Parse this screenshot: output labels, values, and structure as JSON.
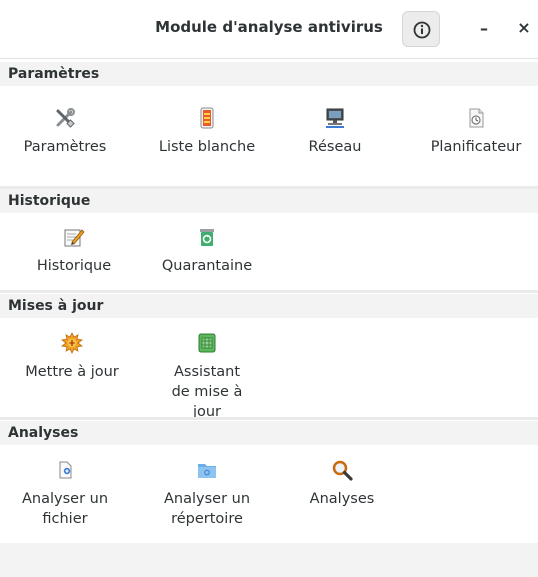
{
  "window": {
    "title": "Module d'analyse antivirus",
    "minimize_label": "–",
    "close_label": "×"
  },
  "sections": [
    {
      "header": "Paramètres",
      "items": [
        {
          "label": "Paramètres",
          "icon": "tools-icon"
        },
        {
          "label": "Liste blanche",
          "icon": "whitelist-icon"
        },
        {
          "label": "Réseau",
          "icon": "network-icon"
        },
        {
          "label": "Planificateur",
          "icon": "scheduler-icon"
        }
      ]
    },
    {
      "header": "Historique",
      "items": [
        {
          "label": "Historique",
          "icon": "history-icon"
        },
        {
          "label": "Quarantaine",
          "icon": "quarantine-icon"
        }
      ]
    },
    {
      "header": "Mises à jour",
      "items": [
        {
          "label": "Mettre à jour",
          "icon": "update-icon"
        },
        {
          "label": "Assistant de mise à jour",
          "icon": "update-assistant-icon"
        }
      ]
    },
    {
      "header": "Analyses",
      "items": [
        {
          "label": "Analyser un fichier",
          "icon": "scan-file-icon"
        },
        {
          "label": "Analyser un répertoire",
          "icon": "scan-folder-icon"
        },
        {
          "label": "Analyses",
          "icon": "magnifier-icon"
        }
      ]
    }
  ]
}
